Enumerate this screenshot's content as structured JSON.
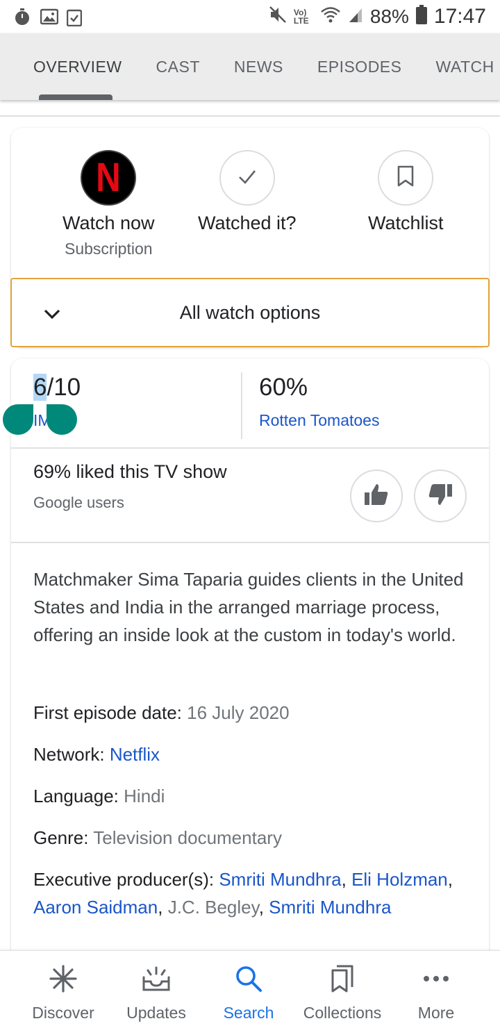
{
  "status_bar": {
    "left_icons": [
      "timer-icon",
      "image-icon",
      "clipboard-check-icon"
    ],
    "right_icons": [
      "mute-icon",
      "volte-icon",
      "wifi-icon",
      "signal-icon",
      "battery-icon"
    ],
    "volte_label": "Vo) LTE",
    "battery": "88%",
    "time": "17:47"
  },
  "tabs": [
    {
      "label": "OVERVIEW",
      "active": true
    },
    {
      "label": "CAST"
    },
    {
      "label": "NEWS"
    },
    {
      "label": "EPISODES"
    },
    {
      "label": "WATCH SHOW"
    }
  ],
  "actions": {
    "watch_now": {
      "label": "Watch now",
      "sub": "Subscription",
      "provider_logo": "N"
    },
    "watched_it": {
      "label": "Watched it?"
    },
    "watchlist": {
      "label": "Watchlist"
    }
  },
  "watch_options": {
    "label": "All watch options"
  },
  "ratings": {
    "imdb": {
      "score_first": "6",
      "score_rest": "/10",
      "source": "IMDb"
    },
    "rt": {
      "score": "60%",
      "source": "Rotten Tomatoes"
    }
  },
  "liked": {
    "text": "69% liked this TV show",
    "sub": "Google users"
  },
  "description": "Matchmaker Sima Taparia guides clients in the United States and India in the arranged marriage process, offering an inside look at the custom in today's world.",
  "info": {
    "first_episode_label": "First episode date: ",
    "first_episode_value": "16 July 2020",
    "network_label": "Network: ",
    "network_value": "Netflix",
    "language_label": "Language: ",
    "language_value": "Hindi",
    "genre_label": "Genre: ",
    "genre_value": "Television documentary",
    "producers_label": "Executive producer(s): ",
    "producers": [
      {
        "name": "Smriti Mundhra",
        "link": true
      },
      {
        "name": "Eli Holzman",
        "link": true
      },
      {
        "name": "Aaron Saidman",
        "link": true
      },
      {
        "name": "J.C. Begley",
        "link": false
      },
      {
        "name": "Smriti Mundhra",
        "link": true
      }
    ]
  },
  "bottom_nav": [
    {
      "label": "Discover",
      "icon": "asterisk-icon"
    },
    {
      "label": "Updates",
      "icon": "updates-inbox-icon"
    },
    {
      "label": "Search",
      "icon": "search-icon",
      "active": true
    },
    {
      "label": "Collections",
      "icon": "collections-icon"
    },
    {
      "label": "More",
      "icon": "more-dots-icon"
    }
  ],
  "colors": {
    "link": "#1a56c8",
    "active_nav": "#1a73e8",
    "watch_options_border": "#e3a33b",
    "selection_handle": "#00897b",
    "netflix_red": "#e50914"
  }
}
